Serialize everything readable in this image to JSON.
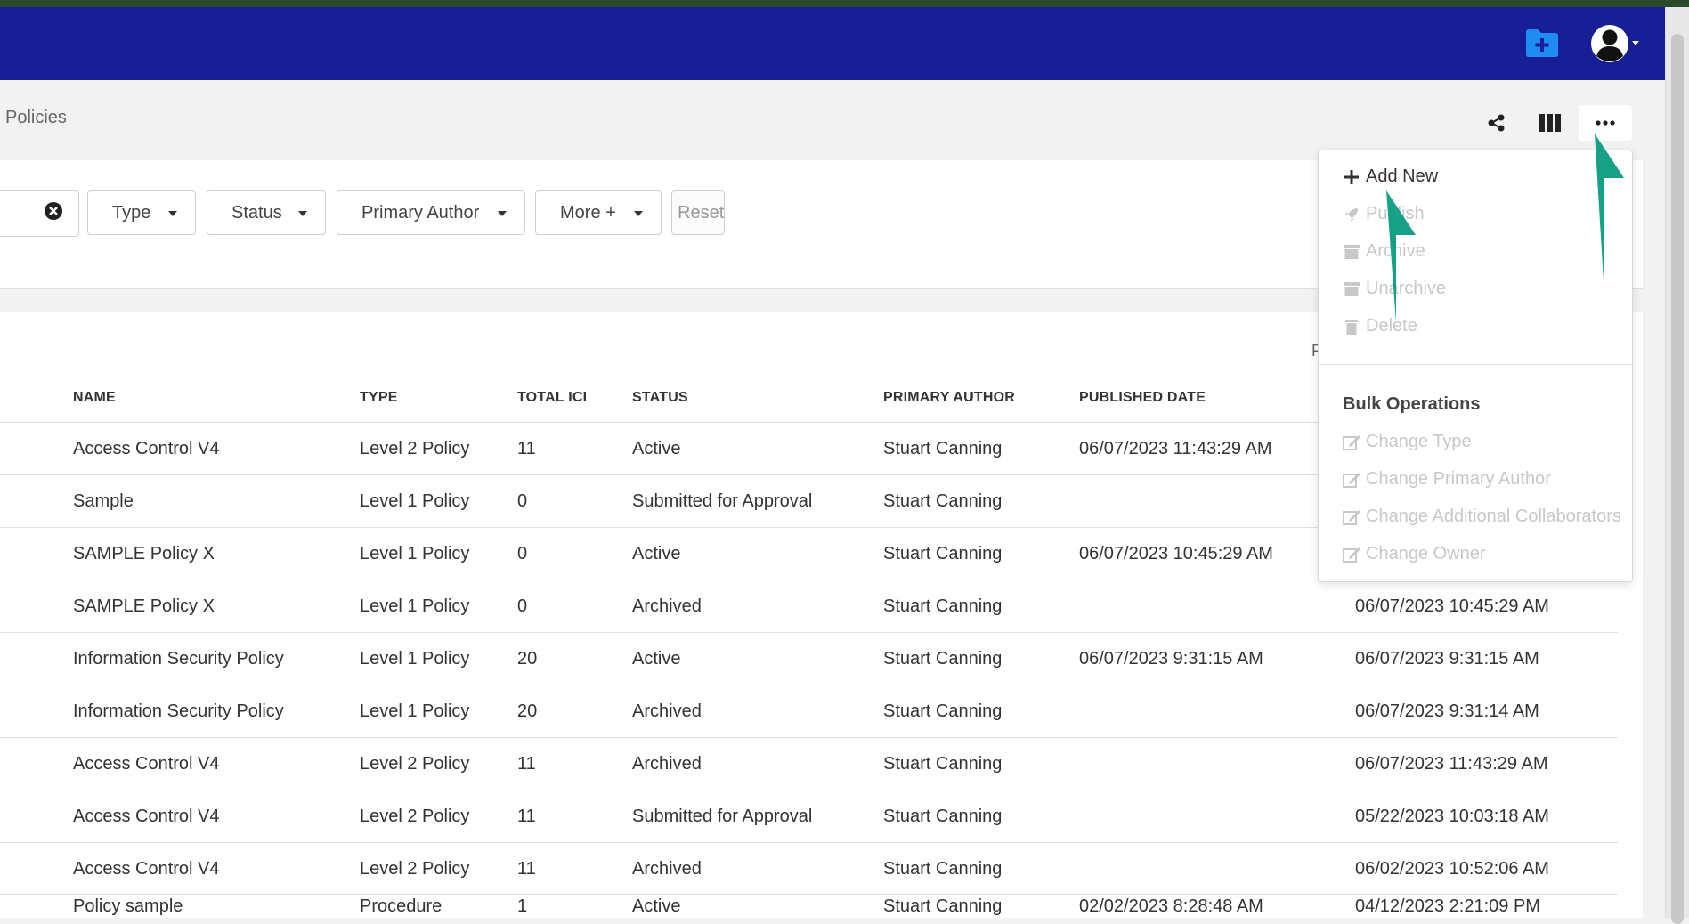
{
  "navbar": {
    "folder_icon": "folder-plus-icon",
    "avatar_icon": "user-avatar-icon",
    "brand_color": "#181e96"
  },
  "page": {
    "title": "Policies"
  },
  "toolbar": {
    "icons": [
      "share-icon",
      "columns-icon",
      "more-ellipsis-icon"
    ]
  },
  "filters": {
    "type_label": "Type",
    "status_label": "Status",
    "author_label": "Primary Author",
    "more_label": "More +",
    "reset_label": "Reset"
  },
  "table": {
    "headers": [
      "NAME",
      "TYPE",
      "TOTAL ICI",
      "STATUS",
      "PRIMARY AUTHOR",
      "PUBLISHED DATE"
    ],
    "partial_header_fragment": "F",
    "rows": [
      {
        "name": "Access Control V4",
        "type": "Level 2 Policy",
        "ici": "11",
        "status": "Active",
        "author": "Stuart Canning",
        "published": "06/07/2023 11:43:29 AM",
        "modified": ""
      },
      {
        "name": "Sample",
        "type": "Level 1 Policy",
        "ici": "0",
        "status": "Submitted for Approval",
        "author": "Stuart Canning",
        "published": "",
        "modified": ""
      },
      {
        "name": "SAMPLE Policy X",
        "type": "Level 1 Policy",
        "ici": "0",
        "status": "Active",
        "author": "Stuart Canning",
        "published": "06/07/2023 10:45:29 AM",
        "modified": ""
      },
      {
        "name": "SAMPLE Policy X",
        "type": "Level 1 Policy",
        "ici": "0",
        "status": "Archived",
        "author": "Stuart Canning",
        "published": "",
        "modified": "06/07/2023 10:45:29 AM"
      },
      {
        "name": "Information Security Policy",
        "type": "Level 1 Policy",
        "ici": "20",
        "status": "Active",
        "author": "Stuart Canning",
        "published": "06/07/2023 9:31:15 AM",
        "modified": "06/07/2023 9:31:15 AM"
      },
      {
        "name": "Information Security Policy",
        "type": "Level 1 Policy",
        "ici": "20",
        "status": "Archived",
        "author": "Stuart Canning",
        "published": "",
        "modified": "06/07/2023 9:31:14 AM"
      },
      {
        "name": "Access Control V4",
        "type": "Level 2 Policy",
        "ici": "11",
        "status": "Archived",
        "author": "Stuart Canning",
        "published": "",
        "modified": "06/07/2023 11:43:29 AM"
      },
      {
        "name": "Access Control V4",
        "type": "Level 2 Policy",
        "ici": "11",
        "status": "Submitted for Approval",
        "author": "Stuart Canning",
        "published": "",
        "modified": "05/22/2023 10:03:18 AM"
      },
      {
        "name": "Access Control V4",
        "type": "Level 2 Policy",
        "ici": "11",
        "status": "Archived",
        "author": "Stuart Canning",
        "published": "",
        "modified": "06/02/2023 10:52:06 AM"
      },
      {
        "name": "Policy sample",
        "type": "Procedure",
        "ici": "1",
        "status": "Active",
        "author": "Stuart Canning",
        "published": "02/02/2023 8:28:48 AM",
        "modified": "04/12/2023 2:21:09 PM"
      }
    ]
  },
  "dropdown": {
    "items": [
      {
        "label": "Add New",
        "icon": "plus-icon",
        "enabled": true
      },
      {
        "label": "Publish",
        "icon": "rocket-icon",
        "enabled": false
      },
      {
        "label": "Archive",
        "icon": "archive-icon",
        "enabled": false
      },
      {
        "label": "Unarchive",
        "icon": "archive-icon",
        "enabled": false
      },
      {
        "label": "Delete",
        "icon": "trash-icon",
        "enabled": false
      }
    ],
    "bulk_header": "Bulk Operations",
    "bulk_items": [
      {
        "label": "Change Type",
        "icon": "edit-icon",
        "enabled": false
      },
      {
        "label": "Change Primary Author",
        "icon": "edit-icon",
        "enabled": false
      },
      {
        "label": "Change Additional Collaborators",
        "icon": "edit-icon",
        "enabled": false
      },
      {
        "label": "Change Owner",
        "icon": "edit-icon",
        "enabled": false
      }
    ]
  },
  "annotation": {
    "arrow_color": "#16a085"
  }
}
